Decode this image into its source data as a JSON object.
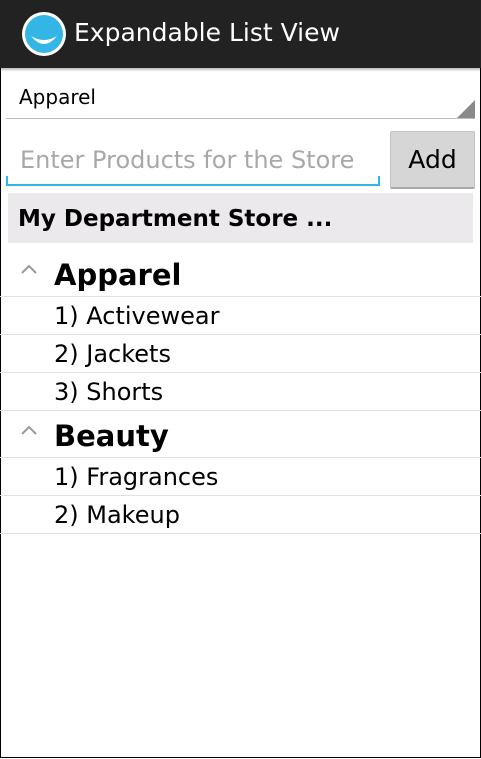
{
  "action_bar": {
    "title": "Expandable List View",
    "icon": "app-face-icon",
    "background_color": "#222222",
    "icon_color": "#33b5e5"
  },
  "spinner": {
    "selected": "Apparel",
    "icon": "dropdown-corner-icon"
  },
  "product_input": {
    "placeholder": "Enter Products for the Store",
    "value": "",
    "underline_color": "#33b5e5"
  },
  "add_button": {
    "label": "Add"
  },
  "list_header": {
    "title": "My Department Store ..."
  },
  "groups": [
    {
      "label": "Apparel",
      "expanded": true,
      "icon": "chevron-up-icon",
      "children": [
        "1) Activewear",
        "2) Jackets",
        "3) Shorts"
      ]
    },
    {
      "label": "Beauty",
      "expanded": true,
      "icon": "chevron-up-icon",
      "children": [
        "1) Fragrances",
        "2) Makeup"
      ]
    }
  ]
}
